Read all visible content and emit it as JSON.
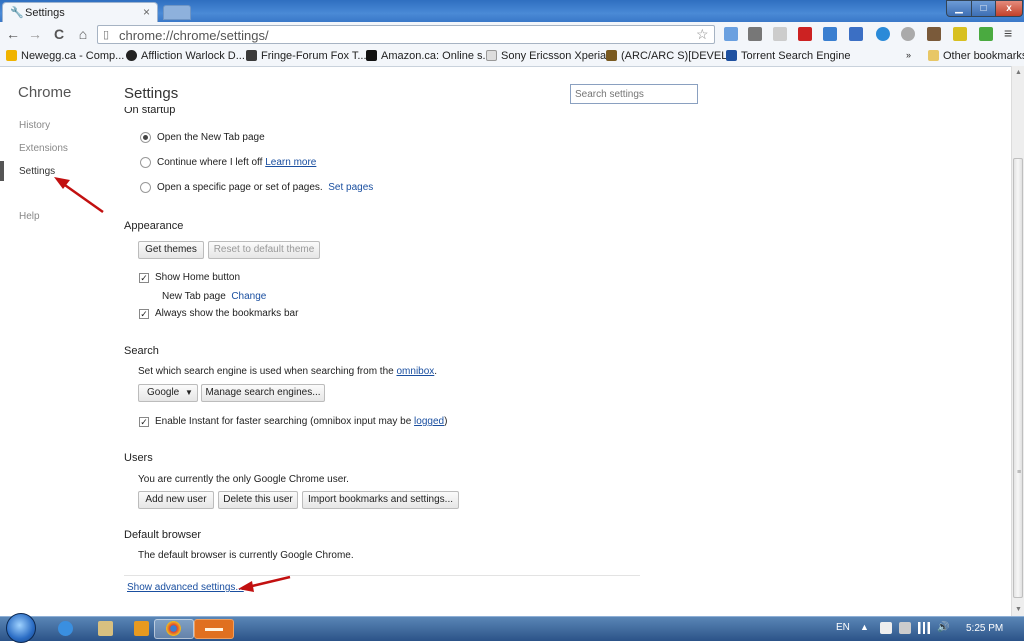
{
  "window": {
    "tab_title": "Settings",
    "tab_close": "×",
    "min_glyph": "▁",
    "max_glyph": "□",
    "close_glyph": "x"
  },
  "toolbar": {
    "back": "←",
    "forward": "→",
    "reload": "C",
    "home": "⌂",
    "url": "chrome://chrome/settings/",
    "star": "☆",
    "menu": "≡"
  },
  "bookmarks": [
    {
      "label": "Newegg.ca - Comp...",
      "color": "#f0b400"
    },
    {
      "label": "Affliction Warlock D...",
      "color": "#222222"
    },
    {
      "label": "Fringe-Forum Fox T...",
      "color": "#3a3a3a"
    },
    {
      "label": "Amazon.ca: Online s...",
      "color": "#111111"
    },
    {
      "label": "Sony Ericsson Xperia...",
      "color": "#dddddd"
    },
    {
      "label": "(ARC/ARC S)[DEVEL...",
      "color": "#7a5a20"
    },
    {
      "label": "Torrent Search Engine",
      "color": "#1e50a0"
    }
  ],
  "other_bookmarks": "Other bookmarks",
  "sidebar": {
    "title": "Chrome",
    "items": [
      "History",
      "Extensions",
      "Settings",
      "Help"
    ]
  },
  "page": {
    "title": "Settings",
    "search_placeholder": "Search settings"
  },
  "startup": {
    "title": "On startup",
    "options": [
      "Open the New Tab page",
      "Continue where I left off",
      "Open a specific page or set of pages."
    ],
    "learn_more": "Learn more",
    "set_pages": "Set pages"
  },
  "appearance": {
    "title": "Appearance",
    "get_themes": "Get themes",
    "reset_theme": "Reset to default theme",
    "show_home": "Show Home button",
    "new_tab_page": "New Tab page",
    "change": "Change",
    "show_bookmarks": "Always show the bookmarks bar"
  },
  "search": {
    "title": "Search",
    "desc": "Set which search engine is used when searching from the",
    "omnibox": "omnibox",
    "engine": "Google",
    "manage": "Manage search engines...",
    "instant": "Enable Instant for faster searching (omnibox input may be",
    "logged": "logged"
  },
  "users": {
    "title": "Users",
    "desc": "You are currently the only Google Chrome user.",
    "add": "Add new user",
    "delete": "Delete this user",
    "import": "Import bookmarks and settings..."
  },
  "default_browser": {
    "title": "Default browser",
    "desc": "The default browser is currently Google Chrome."
  },
  "advanced": "Show advanced settings...",
  "taskbar": {
    "lang": "EN",
    "time": "5:25 PM"
  },
  "colors": {
    "accent_link": "#1a4fa0",
    "annotation_arrow": "#c21010"
  }
}
